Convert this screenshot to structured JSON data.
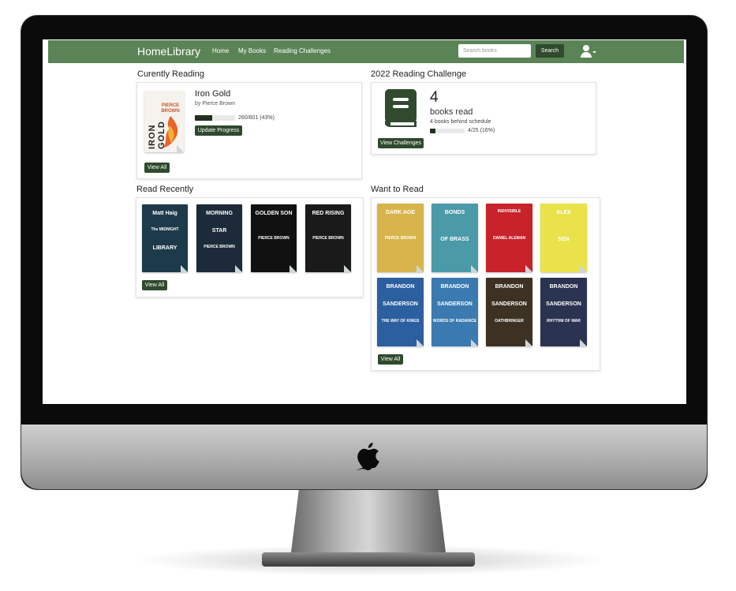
{
  "navbar": {
    "brand": "HomeLibrary",
    "links": [
      "Home",
      "My Books",
      "Reading Challenges"
    ],
    "search_placeholder": "Search books",
    "search_button": "Search"
  },
  "currently_reading": {
    "heading": "Curently Reading",
    "book": {
      "title": "Iron Gold",
      "author": "by Pierce Brown",
      "cover_title": "IRON GOLD",
      "cover_author": "PIERCE BROWN",
      "progress_text": "260/601 (43%)",
      "progress_fraction": 0.43
    },
    "update_button": "Update Progress",
    "view_all": "View All"
  },
  "challenge": {
    "heading": "2022 Reading Challenge",
    "count": "4",
    "count_label": "books read",
    "status": "4 books behind schedule",
    "progress_text": "4/25 (16%)",
    "progress_fraction": 0.16,
    "view_button": "View Challenges"
  },
  "read_recently": {
    "heading": "Read Recently",
    "books": [
      {
        "lines": [
          "Matt Haig",
          "The MIDNIGHT",
          "LIBRARY"
        ],
        "bg": "#1d3a4a"
      },
      {
        "lines": [
          "MORNING",
          "STAR",
          "PIERCE BROWN"
        ],
        "bg": "#1c2a3a"
      },
      {
        "lines": [
          "GOLDEN SON",
          "PIERCE BROWN"
        ],
        "bg": "#111111"
      },
      {
        "lines": [
          "RED RISING",
          "PIERCE BROWN"
        ],
        "bg": "#1a1a1a"
      }
    ],
    "view_all": "View All"
  },
  "want_to_read": {
    "heading": "Want to Read",
    "books": [
      {
        "lines": [
          "DARK AGE",
          "PIERCE BROWN"
        ],
        "bg": "#d8b44a"
      },
      {
        "lines": [
          "BONDS",
          "OF BRASS"
        ],
        "bg": "#4a9aa8"
      },
      {
        "lines": [
          "INDIVISIBLE",
          "DANIEL ALEMAN"
        ],
        "bg": "#c8222a"
      },
      {
        "lines": [
          "ALEX",
          "SEN"
        ],
        "bg": "#e9e24a"
      },
      {
        "lines": [
          "BRANDON",
          "SANDERSON",
          "THE WAY OF KINGS"
        ],
        "bg": "#2c5fa0"
      },
      {
        "lines": [
          "BRANDON",
          "SANDERSON",
          "WORDS OF RADIANCE"
        ],
        "bg": "#3a7ab0"
      },
      {
        "lines": [
          "BRANDON",
          "SANDERSON",
          "OATHBRINGER"
        ],
        "bg": "#3c3122"
      },
      {
        "lines": [
          "BRANDON",
          "SANDERSON",
          "RHYTHM OF WAR"
        ],
        "bg": "#2a3350"
      }
    ],
    "view_all": "View All"
  },
  "colors": {
    "navbar": "#5b8456",
    "button": "#2f4a2d",
    "book_icon": "#2f4a2d"
  }
}
